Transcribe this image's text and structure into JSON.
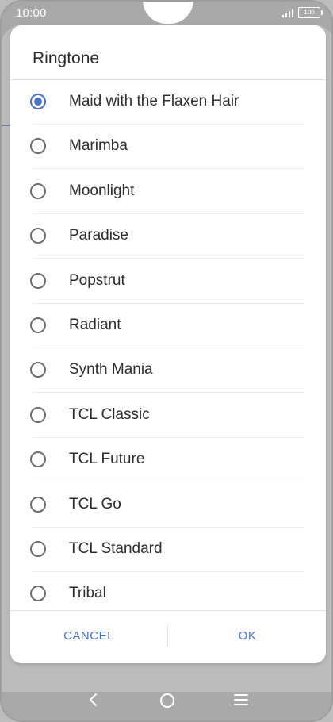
{
  "status_bar": {
    "time": "10:00",
    "battery": "100",
    "icons": [
      "signal-icon",
      "battery-icon"
    ]
  },
  "dialog": {
    "title": "Ringtone",
    "items": [
      {
        "label": "Maid with the Flaxen Hair",
        "selected": true
      },
      {
        "label": "Marimba",
        "selected": false
      },
      {
        "label": "Moonlight",
        "selected": false
      },
      {
        "label": "Paradise",
        "selected": false
      },
      {
        "label": "Popstrut",
        "selected": false
      },
      {
        "label": "Radiant",
        "selected": false
      },
      {
        "label": "Synth Mania",
        "selected": false
      },
      {
        "label": "TCL Classic",
        "selected": false
      },
      {
        "label": "TCL Future",
        "selected": false
      },
      {
        "label": "TCL Go",
        "selected": false
      },
      {
        "label": "TCL Standard",
        "selected": false
      },
      {
        "label": "Tribal",
        "selected": false
      }
    ],
    "cancel_label": "CANCEL",
    "ok_label": "OK"
  },
  "nav": {
    "icons": [
      "back-icon",
      "home-icon",
      "menu-icon"
    ]
  },
  "colors": {
    "accent": "#4a73c4",
    "radio_unselected": "#6e6e6e",
    "text": "#2c2c2c"
  }
}
